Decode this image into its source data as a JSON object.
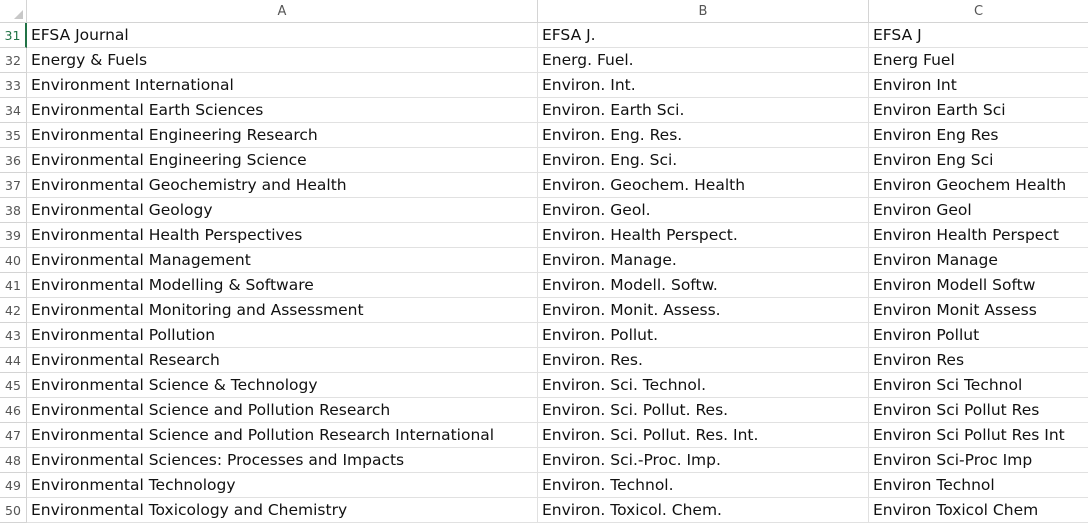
{
  "columns": [
    "A",
    "B",
    "C"
  ],
  "rows": [
    {
      "num": "31",
      "a": "EFSA Journal",
      "b": "EFSA J.",
      "c": "EFSA J"
    },
    {
      "num": "32",
      "a": "Energy & Fuels",
      "b": "Energ. Fuel.",
      "c": "Energ Fuel"
    },
    {
      "num": "33",
      "a": "Environment International",
      "b": "Environ. Int.",
      "c": "Environ Int"
    },
    {
      "num": "34",
      "a": "Environmental Earth Sciences",
      "b": "Environ. Earth Sci.",
      "c": "Environ Earth Sci"
    },
    {
      "num": "35",
      "a": "Environmental Engineering Research",
      "b": "Environ. Eng. Res.",
      "c": "Environ Eng Res"
    },
    {
      "num": "36",
      "a": "Environmental Engineering Science",
      "b": "Environ. Eng. Sci.",
      "c": "Environ Eng Sci"
    },
    {
      "num": "37",
      "a": "Environmental Geochemistry and Health",
      "b": "Environ. Geochem. Health",
      "c": "Environ Geochem Health"
    },
    {
      "num": "38",
      "a": "Environmental Geology",
      "b": "Environ. Geol.",
      "c": "Environ Geol"
    },
    {
      "num": "39",
      "a": "Environmental Health Perspectives",
      "b": "Environ. Health Perspect.",
      "c": "Environ Health Perspect"
    },
    {
      "num": "40",
      "a": "Environmental Management",
      "b": "Environ. Manage.",
      "c": "Environ Manage"
    },
    {
      "num": "41",
      "a": "Environmental Modelling & Software",
      "b": "Environ. Modell. Softw.",
      "c": "Environ Modell Softw"
    },
    {
      "num": "42",
      "a": "Environmental Monitoring and Assessment",
      "b": "Environ. Monit. Assess.",
      "c": "Environ Monit Assess"
    },
    {
      "num": "43",
      "a": "Environmental Pollution",
      "b": "Environ. Pollut.",
      "c": "Environ Pollut"
    },
    {
      "num": "44",
      "a": "Environmental Research",
      "b": "Environ. Res.",
      "c": "Environ Res"
    },
    {
      "num": "45",
      "a": "Environmental Science & Technology",
      "b": "Environ. Sci. Technol.",
      "c": "Environ Sci Technol"
    },
    {
      "num": "46",
      "a": "Environmental Science and Pollution Research",
      "b": "Environ. Sci. Pollut. Res.",
      "c": "Environ Sci Pollut Res"
    },
    {
      "num": "47",
      "a": "Environmental Science and Pollution Research International",
      "b": "Environ. Sci. Pollut. Res. Int.",
      "c": "Environ Sci Pollut Res Int"
    },
    {
      "num": "48",
      "a": "Environmental Sciences: Processes and Impacts",
      "b": "Environ. Sci.-Proc. Imp.",
      "c": "Environ Sci-Proc Imp"
    },
    {
      "num": "49",
      "a": "Environmental Technology",
      "b": "Environ. Technol.",
      "c": "Environ Technol"
    },
    {
      "num": "50",
      "a": "Environmental Toxicology and Chemistry",
      "b": "Environ. Toxicol. Chem.",
      "c": "Environ Toxicol Chem"
    }
  ],
  "colors": {
    "accent": "#217346",
    "grid": "#e1e1e1"
  }
}
